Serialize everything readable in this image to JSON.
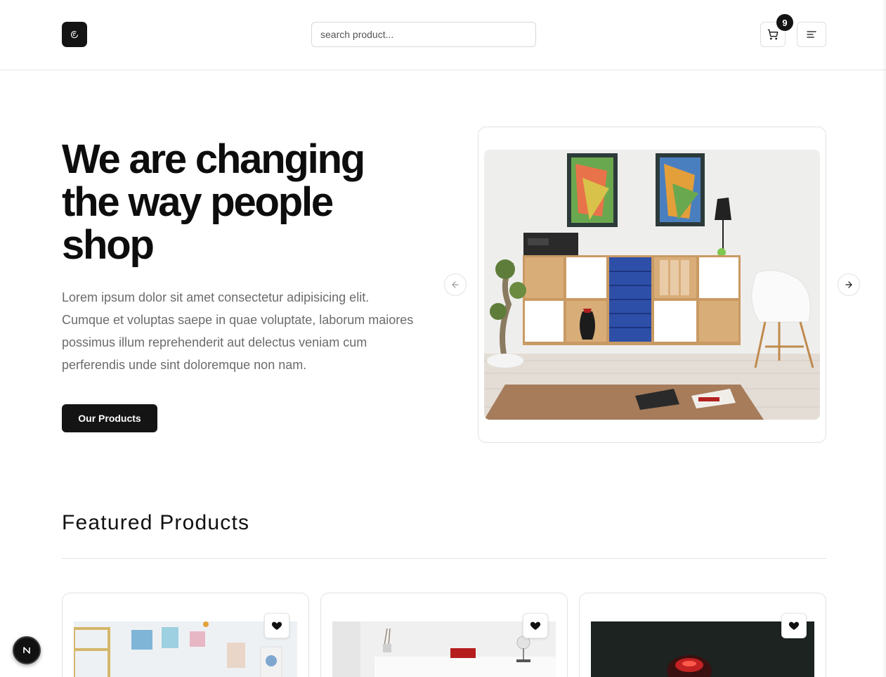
{
  "header": {
    "search_placeholder": "search product...",
    "cart_count": "9"
  },
  "hero": {
    "title": "We are changing the way people shop",
    "text": "Lorem ipsum dolor sit amet consectetur adipisicing elit. Cumque et voluptas saepe in quae voluptate, laborum maiores possimus illum reprehenderit aut delectus veniam cum perferendis unde sint doloremque non nam.",
    "cta_label": "Our Products"
  },
  "featured": {
    "title": "Featured Products"
  },
  "colors": {
    "primary": "#141414",
    "muted_text": "#6b6b6b",
    "border": "#e2e2e2"
  },
  "icons": {
    "logo": "logo-icon",
    "cart": "cart-icon",
    "menu": "menu-icon",
    "prev": "arrow-left-icon",
    "next": "arrow-right-icon",
    "wishlist": "heart-icon",
    "dev_badge": "nextjs-icon"
  }
}
